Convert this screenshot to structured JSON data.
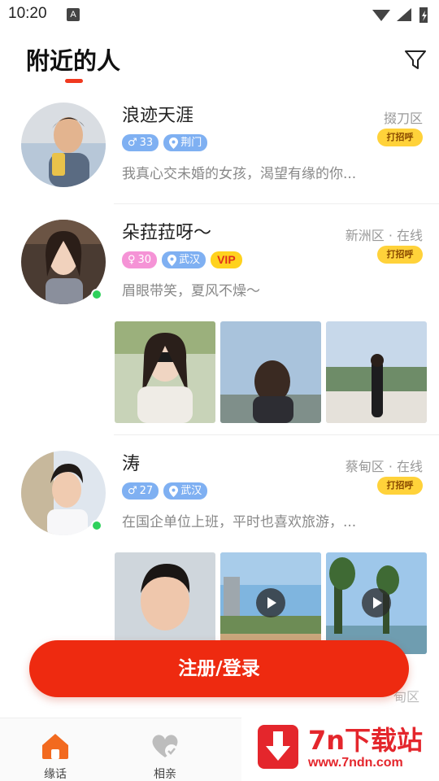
{
  "status_bar": {
    "time": "10:20",
    "notif_badge": "A"
  },
  "header": {
    "title": "附近的人",
    "accent_color": "#f0391f"
  },
  "users": [
    {
      "name": "浪迹天涯",
      "location": "掇刀区",
      "greet_label": "打招呼",
      "gender_symbol": "♂",
      "age": "33",
      "city": "荆门",
      "bio": "我真心交未婚的女孩，渴望有缘的你...",
      "online": false
    },
    {
      "name": "朵菈菈呀～",
      "location": "新洲区 · 在线",
      "greet_label": "打招呼",
      "gender_symbol": "♀",
      "age": "30",
      "city": "武汉",
      "vip": "VIP",
      "bio": "眉眼带笑，夏风不燥～",
      "online": true
    },
    {
      "name": "涛",
      "location": "蔡甸区 · 在线",
      "greet_label": "打招呼",
      "gender_symbol": "♂",
      "age": "27",
      "city": "武汉",
      "bio": "在国企单位上班，平时也喜欢旅游，...",
      "online": true
    }
  ],
  "partial_next_location": "甸区",
  "register_label": "注册/登录",
  "bottom_nav": [
    {
      "label": "缘话",
      "icon": "home-icon",
      "active": true
    },
    {
      "label": "相亲",
      "icon": "heart-icon",
      "active": false
    }
  ],
  "watermark": {
    "title": "7n下载站",
    "url": "www.7ndn.com"
  },
  "colors": {
    "primary": "#ee2a10",
    "greet": "#ffd23a",
    "tag_blue": "#7fb0f2",
    "tag_pink": "#f593d6",
    "online": "#2ed15b"
  }
}
